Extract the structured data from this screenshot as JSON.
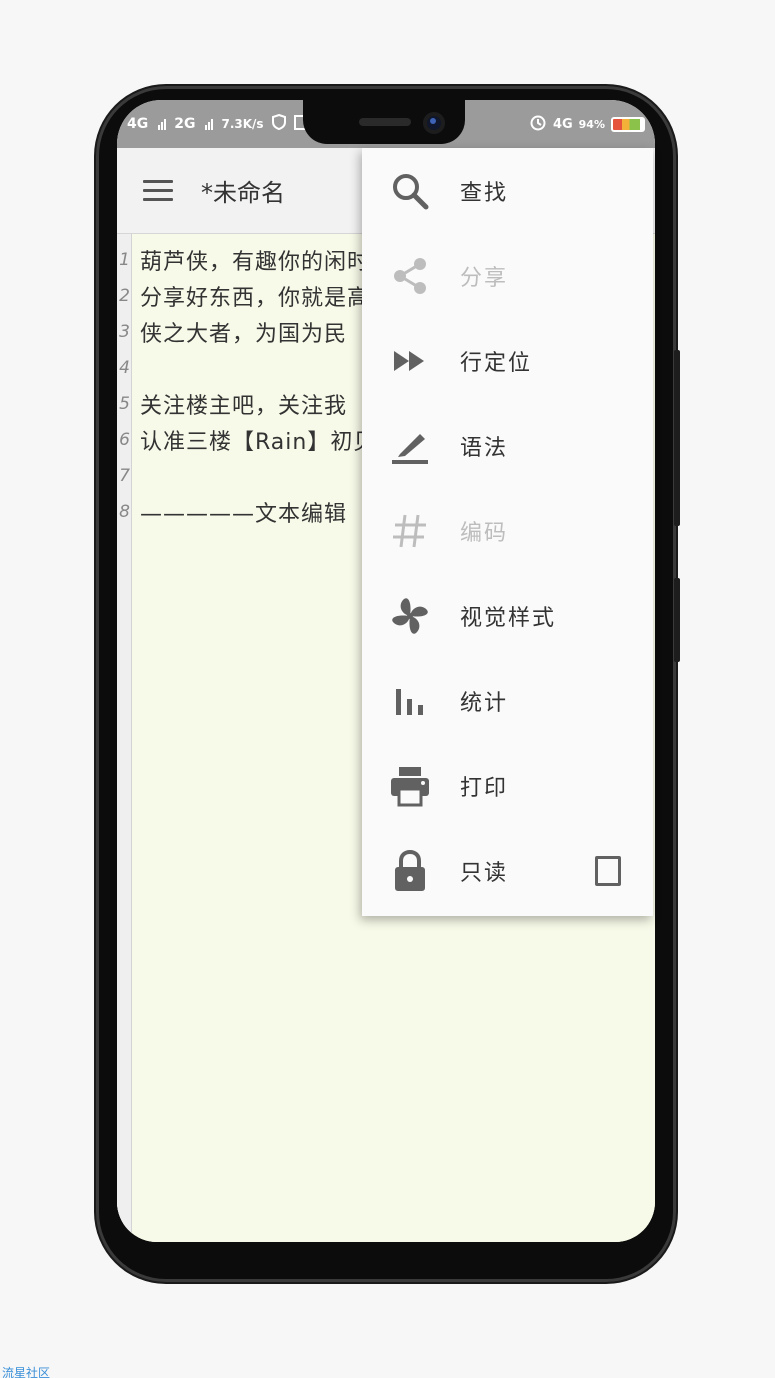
{
  "status_bar": {
    "sim1": "4G",
    "sim2": "2G",
    "speed": "7.3K/s",
    "network_right": "4G",
    "battery_percent": "94%"
  },
  "toolbar": {
    "menu_icon": "hamburger-menu-icon",
    "title": "*未命名"
  },
  "editor": {
    "lines": [
      {
        "num": "1",
        "text": "葫芦侠，有趣你的闲时"
      },
      {
        "num": "2",
        "text": "分享好东西，你就是高"
      },
      {
        "num": "3",
        "text": "侠之大者，为国为民"
      },
      {
        "num": "4",
        "text": ""
      },
      {
        "num": "5",
        "text": "关注楼主吧，关注我"
      },
      {
        "num": "6",
        "text": "认准三楼【Rain】初见"
      },
      {
        "num": "7",
        "text": ""
      },
      {
        "num": "8",
        "text": "—————文本编辑"
      }
    ]
  },
  "menu": {
    "items": [
      {
        "label": "查找",
        "icon": "search-icon",
        "enabled": true
      },
      {
        "label": "分享",
        "icon": "share-icon",
        "enabled": false
      },
      {
        "label": "行定位",
        "icon": "fast-forward-icon",
        "enabled": true
      },
      {
        "label": "语法",
        "icon": "pen-underline-icon",
        "enabled": true
      },
      {
        "label": "编码",
        "icon": "hash-icon",
        "enabled": false
      },
      {
        "label": "视觉样式",
        "icon": "pinwheel-icon",
        "enabled": true
      },
      {
        "label": "统计",
        "icon": "bar-chart-icon",
        "enabled": true
      },
      {
        "label": "打印",
        "icon": "printer-icon",
        "enabled": true
      },
      {
        "label": "只读",
        "icon": "lock-icon",
        "enabled": true,
        "checked": false
      }
    ]
  },
  "watermark": "流星社区",
  "colors": {
    "editor_bg": "#f8fae9",
    "status_bar_bg": "#9b9b9b",
    "icon_gray": "#616161",
    "disabled_gray": "#bdbdbd"
  }
}
